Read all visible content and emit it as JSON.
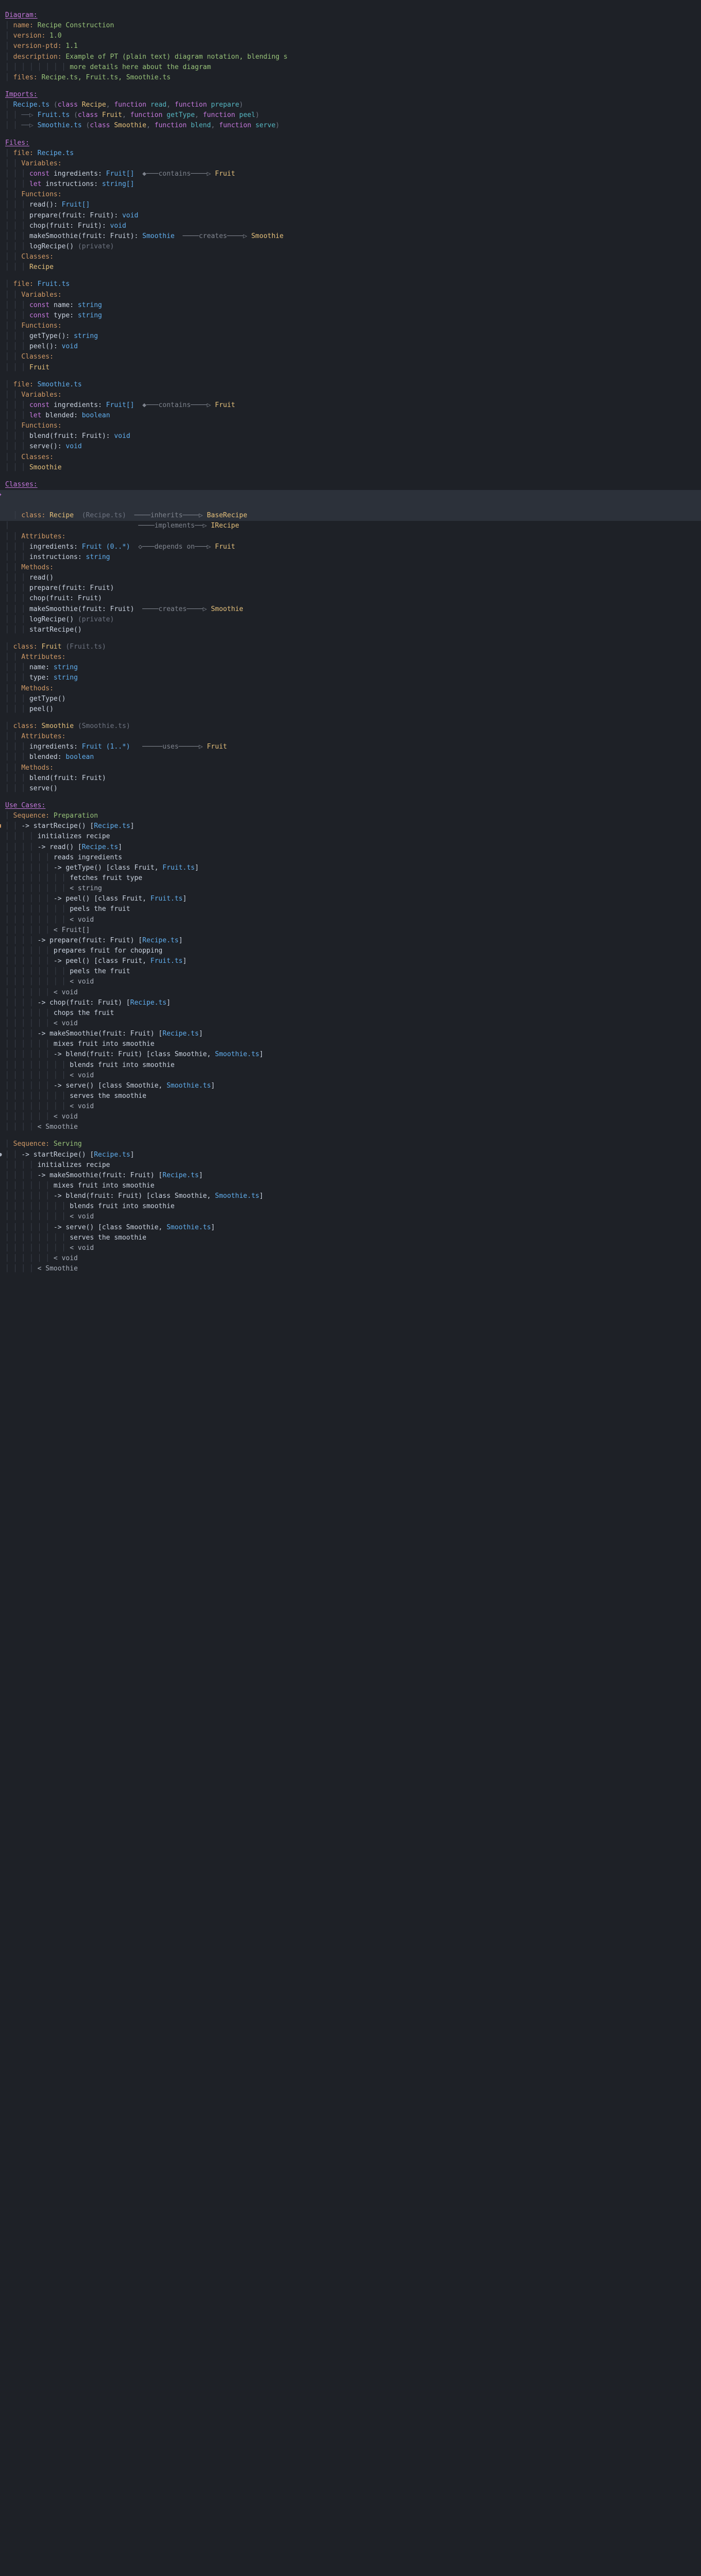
{
  "headers": {
    "diagram": "Diagram:",
    "imports": "Imports:",
    "files": "Files:",
    "classes": "Classes:",
    "usecases": "Use Cases:"
  },
  "diagram": {
    "name_key": "name:",
    "name_val": "Recipe Construction",
    "version_key": "version:",
    "version_val": "1.0",
    "versionptd_key": "version-ptd:",
    "versionptd_val": "1.1",
    "description_key": "description:",
    "description_val": "Example of PT (plain text) diagram notation, blending s",
    "description_cont": "more details here about the diagram",
    "files_key": "files:",
    "files_val": "Recipe.ts, Fruit.ts, Smoothie.ts"
  },
  "imports": {
    "l1_file": "Recipe.ts",
    "l1_rest": " (class Recipe, function read, function prepare)",
    "l2_file": "Fruit.ts",
    "l2_rest": " (class Fruit, function getType, function peel)",
    "l3_file": "Smoothie.ts",
    "l3_rest": " (class Smoothie, function blend, function serve)"
  },
  "files": {
    "f1": {
      "file_key": "file:",
      "file_val": "Recipe.ts",
      "vars_key": "Variables:",
      "v1_kw": "const ",
      "v1_name": "ingredients:",
      "v1_type": " Fruit[]",
      "v1_arrow": "  ◆───contains────▷ ",
      "v1_target": "Fruit",
      "v2_kw": "let ",
      "v2_name": "instructions:",
      "v2_type": " string[]",
      "funcs_key": "Functions:",
      "fn1": "read():",
      "fn1_t": " Fruit[]",
      "fn2": "prepare(fruit: Fruit):",
      "fn2_t": " void",
      "fn3": "chop(fruit: Fruit):",
      "fn3_t": " void",
      "fn4": "makeSmoothie(fruit: Fruit):",
      "fn4_t": " Smoothie",
      "fn4_arrow": "  ────creates────▷ ",
      "fn4_target": "Smoothie",
      "fn5": "logRecipe()",
      "fn5_t": " (private)",
      "classes_key": "Classes:",
      "cls1": "Recipe"
    },
    "f2": {
      "file_key": "file:",
      "file_val": "Fruit.ts",
      "vars_key": "Variables:",
      "v1_kw": "const ",
      "v1_name": "name:",
      "v1_type": " string",
      "v2_kw": "const ",
      "v2_name": "type:",
      "v2_type": " string",
      "funcs_key": "Functions:",
      "fn1": "getType():",
      "fn1_t": " string",
      "fn2": "peel():",
      "fn2_t": " void",
      "classes_key": "Classes:",
      "cls1": "Fruit"
    },
    "f3": {
      "file_key": "file:",
      "file_val": "Smoothie.ts",
      "vars_key": "Variables:",
      "v1_kw": "const ",
      "v1_name": "ingredients:",
      "v1_type": " Fruit[]",
      "v1_arrow": "  ◆───contains────▷ ",
      "v1_target": "Fruit",
      "v2_kw": "let ",
      "v2_name": "blended:",
      "v2_type": " boolean",
      "funcs_key": "Functions:",
      "fn1": "blend(fruit: Fruit):",
      "fn1_t": " void",
      "fn2": "serve():",
      "fn2_t": " void",
      "classes_key": "Classes:",
      "cls1": "Smoothie"
    }
  },
  "classes": {
    "c1": {
      "kw": "class:",
      "name": " Recipe",
      "loc": "  (Recipe.ts)",
      "inh_arrow": "  ────inherits────▷ ",
      "inh_target": "BaseRecipe",
      "impl_arrow": "                               ────implements──▷ ",
      "impl_target": "IRecipe",
      "attrs_key": "Attributes:",
      "a1": "ingredients:",
      "a1_t": " Fruit (0..*)",
      "a1_arrow": "  ◇───depends on───▷ ",
      "a1_target": "Fruit",
      "a2": "instructions:",
      "a2_t": " string",
      "methods_key": "Methods:",
      "m1": "read()",
      "m2": "prepare(fruit: Fruit)",
      "m3": "chop(fruit: Fruit)",
      "m4": "makeSmoothie(fruit: Fruit)",
      "m4_arrow": "  ────creates────▷ ",
      "m4_target": "Smoothie",
      "m5": "logRecipe()",
      "m5_t": " (private)",
      "m6": "startRecipe()"
    },
    "c2": {
      "kw": "class:",
      "name": " Fruit",
      "loc": " (Fruit.ts)",
      "attrs_key": "Attributes:",
      "a1": "name:",
      "a1_t": " string",
      "a2": "type:",
      "a2_t": " string",
      "methods_key": "Methods:",
      "m1": "getType()",
      "m2": "peel()"
    },
    "c3": {
      "kw": "class:",
      "name": " Smoothie",
      "loc": " (Smoothie.ts)",
      "attrs_key": "Attributes:",
      "a1": "ingredients:",
      "a1_t": " Fruit (1..*)",
      "a1_arrow": "   ─────uses─────▷ ",
      "a1_target": "Fruit",
      "a2": "blended:",
      "a2_t": " boolean",
      "methods_key": "Methods:",
      "m1": "blend(fruit: Fruit)",
      "m2": "serve()"
    }
  },
  "usecases": {
    "seq1": {
      "title_key": "Sequence:",
      "title_val": " Preparation",
      "l01": "-> startRecipe() [",
      "l01b": "Recipe.ts",
      "l01c": "]",
      "l02": "initializes recipe",
      "l03": "-> read() [",
      "l03b": "Recipe.ts",
      "l03c": "]",
      "l04": "reads ingredients",
      "l05": "-> getType() [class Fruit, ",
      "l05b": "Fruit.ts",
      "l05c": "]",
      "l06": "fetches fruit type",
      "l07": "< string",
      "l08": "-> peel() [class Fruit, ",
      "l08b": "Fruit.ts",
      "l08c": "]",
      "l09": "peels the fruit",
      "l10": "< void",
      "l11": "< Fruit[]",
      "l12": "-> prepare(fruit: Fruit) [",
      "l12b": "Recipe.ts",
      "l12c": "]",
      "l13": "prepares fruit for chopping",
      "l14": "-> peel() [class Fruit, ",
      "l14b": "Fruit.ts",
      "l14c": "]",
      "l15": "peels the fruit",
      "l16": "< void",
      "l17": "< void",
      "l18": "-> chop(fruit: Fruit) [",
      "l18b": "Recipe.ts",
      "l18c": "]",
      "l19": "chops the fruit",
      "l20": "< void",
      "l21": "-> makeSmoothie(fruit: Fruit) [",
      "l21b": "Recipe.ts",
      "l21c": "]",
      "l22": "mixes fruit into smoothie",
      "l23": "-> blend(fruit: Fruit) [class Smoothie, ",
      "l23b": "Smoothie.ts",
      "l23c": "]",
      "l24": "blends fruit into smoothie",
      "l25": "< void",
      "l26": "-> serve() [class Smoothie, ",
      "l26b": "Smoothie.ts",
      "l26c": "]",
      "l27": "serves the smoothie",
      "l28": "< void",
      "l29": "< void",
      "l30": "< Smoothie"
    },
    "seq2": {
      "title_key": "Sequence:",
      "title_val": " Serving",
      "l01": "-> startRecipe() [",
      "l01b": "Recipe.ts",
      "l01c": "]",
      "l02": "initializes recipe",
      "l21": "-> makeSmoothie(fruit: Fruit) [",
      "l21b": "Recipe.ts",
      "l21c": "]",
      "l22": "mixes fruit into smoothie",
      "l23": "-> blend(fruit: Fruit) [class Smoothie, ",
      "l23b": "Smoothie.ts",
      "l23c": "]",
      "l24": "blends fruit into smoothie",
      "l25": "< void",
      "l26": "-> serve() [class Smoothie, ",
      "l26b": "Smoothie.ts",
      "l26c": "]",
      "l27": "serves the smoothie",
      "l28": "< void",
      "l29": "< void",
      "l30": "< Smoothie"
    }
  },
  "tokens": {
    "class": "class ",
    "function": "function ",
    "const": "const ",
    "let": "let ",
    "imp_arrow": "──▷ "
  }
}
